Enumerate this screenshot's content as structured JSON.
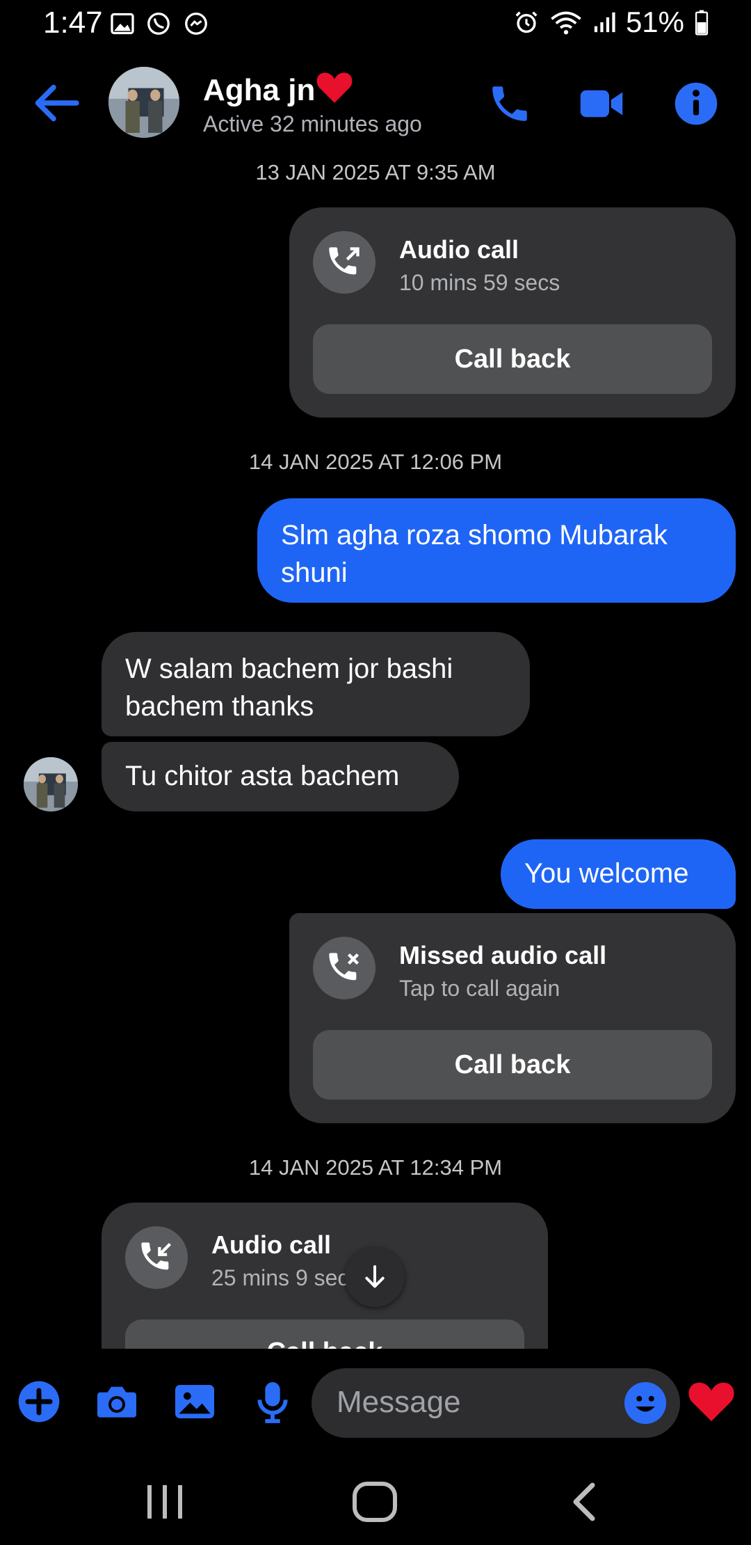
{
  "status_bar": {
    "time": "1:47",
    "battery": "51%"
  },
  "header": {
    "contact_name": "Agha jn",
    "heart_emoji": "❤️",
    "active_status": "Active 32 minutes ago",
    "icons": [
      "back-arrow-icon",
      "phone-icon",
      "video-icon",
      "info-icon"
    ]
  },
  "messages": {
    "ts1": "13 JAN 2025 AT 9:35 AM",
    "call1": {
      "title": "Audio call",
      "sub": "10 mins 59 secs",
      "button": "Call back"
    },
    "ts2": "14 JAN 2025 AT 12:06 PM",
    "out1": "Slm agha roza shomo Mubarak shuni",
    "in1": "W salam  bachem  jor bashi bachem  thanks",
    "in2": "Tu chitor asta bachem",
    "out2": "You welcome",
    "call2": {
      "title": "Missed audio call",
      "sub": "Tap to call again",
      "button": "Call back"
    },
    "ts3": "14 JAN 2025 AT 12:34 PM",
    "call3": {
      "title": "Audio call",
      "sub": "25 mins 9 secs",
      "button": "Call back"
    }
  },
  "composer": {
    "placeholder": "Message"
  },
  "colors": {
    "accent": "#1f65f5",
    "icon_blue": "#2b6cf6",
    "bubble_in": "#303033",
    "card": "#333335"
  }
}
